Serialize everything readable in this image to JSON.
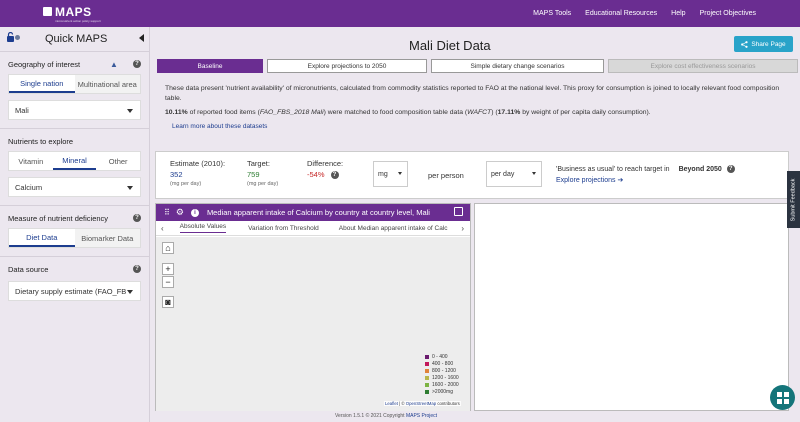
{
  "brand": {
    "name": "MAPS",
    "tagline": "micronutrient action policy support"
  },
  "nav": {
    "items": [
      "MAPS Tools",
      "Educational Resources",
      "Help",
      "Project Objectives"
    ]
  },
  "sidebar": {
    "title": "Quick MAPS",
    "geography": {
      "label": "Geography of interest",
      "tabs": [
        "Single nation",
        "Multinational area"
      ],
      "selected": "Mali"
    },
    "nutrients": {
      "label": "Nutrients to explore",
      "tabs": [
        "Vitamin",
        "Mineral",
        "Other"
      ],
      "selected": "Calcium"
    },
    "measure": {
      "label": "Measure of nutrient deficiency",
      "tabs": [
        "Diet Data",
        "Biomarker Data"
      ]
    },
    "datasource": {
      "label": "Data source",
      "selected": "Dietary supply estimate (FAO_FB"
    }
  },
  "main": {
    "title": "Mali Diet Data",
    "share_label": "Share Page",
    "tabs": [
      "Baseline",
      "Explore projections to 2050",
      "Simple dietary change scenarios",
      "Explore cost effectiveness scenarios"
    ],
    "description": "These data present 'nutrient availability' of micronutrients, calculated from commodity statistics reported to FAO at the national level. This proxy for consumption is joined to locally relevant food composition table.",
    "match": {
      "pct1": "10.11%",
      "text1": " of reported food items (",
      "src1": "FAO_FBS_2018 Mali",
      "text2": ") were matched to food composition table data (",
      "src2": "WAFCT",
      "text3": ") (",
      "pct2": "17.11%",
      "text4": " by weight of per capita daily consumption)."
    },
    "learn_more": "Learn more about these datasets",
    "estimate": {
      "est_label": "Estimate (2010):",
      "est_value": "352",
      "est_unit": "(mg per day)",
      "target_label": "Target:",
      "target_value": "759",
      "target_unit": "(mg per day)",
      "diff_label": "Difference:",
      "diff_value": "-54%",
      "unit_select": "mg",
      "per_person": "per person",
      "period_select": "per day",
      "bau_text": "'Business as usual' to reach target in",
      "bau_value": "Beyond 2050",
      "explore_link": "Explore projections"
    },
    "map": {
      "title": "Median apparent intake of Calcium by country at country level, Mali",
      "tabs": [
        "Absolute Values",
        "Variation from Threshold",
        "About Median apparent intake of Calc"
      ],
      "legend": [
        {
          "label": "0 - 400",
          "color": "#6a1b6e"
        },
        {
          "label": "400 - 800",
          "color": "#c2185b"
        },
        {
          "label": "800 - 1200",
          "color": "#e0833a"
        },
        {
          "label": "1200 - 1600",
          "color": "#b8b64a"
        },
        {
          "label": "1600 - 2000",
          "color": "#7cb342"
        },
        {
          "label": ">2000mg",
          "color": "#2e7d32"
        }
      ],
      "attribution_leaflet": "Leaflet",
      "attribution_sep": " | © ",
      "attribution_osm": "OpenStreetMap",
      "attribution_tail": " contributors"
    }
  },
  "footer": {
    "version": "Version 1.5.1 © 2021 Copyright ",
    "link": "MAPS Project"
  },
  "feedback": "Submit Feedback"
}
